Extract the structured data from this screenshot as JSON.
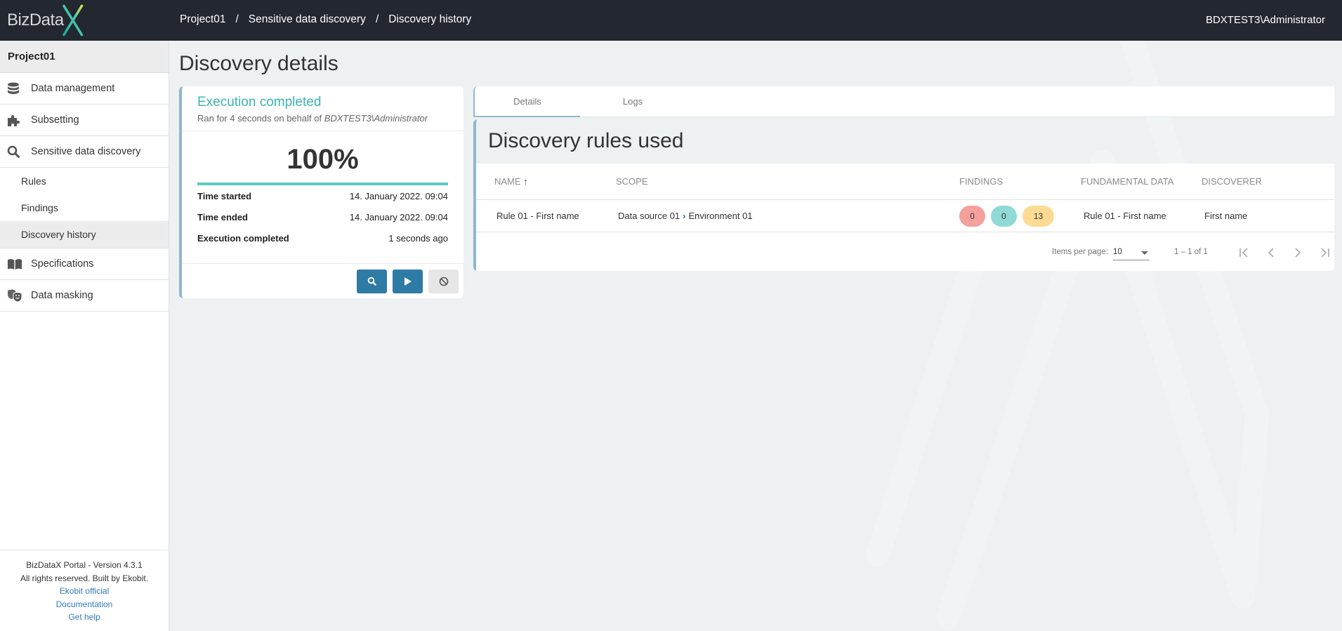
{
  "header": {
    "logo_text": "BizData",
    "breadcrumb": [
      "Project01",
      "Sensitive data discovery",
      "Discovery history"
    ],
    "breadcrumb_separator": "/",
    "user": "BDXTEST3\\Administrator"
  },
  "sidebar": {
    "project": "Project01",
    "items": [
      {
        "label": "Data management",
        "icon": "database-icon"
      },
      {
        "label": "Subsetting",
        "icon": "puzzle-icon"
      },
      {
        "label": "Sensitive data discovery",
        "icon": "search-icon"
      }
    ],
    "sub_items": [
      {
        "label": "Rules",
        "active": false
      },
      {
        "label": "Findings",
        "active": false
      },
      {
        "label": "Discovery history",
        "active": true
      }
    ],
    "items_after": [
      {
        "label": "Specifications",
        "icon": "book-icon"
      },
      {
        "label": "Data masking",
        "icon": "masks-icon"
      }
    ],
    "footer": {
      "version": "BizDataX Portal - Version 4.3.1",
      "rights": "All rights reserved. Built by Ekobit.",
      "links": [
        "Ekobit official",
        "Documentation",
        "Get help"
      ]
    }
  },
  "main": {
    "title": "Discovery details",
    "execution": {
      "status": "Execution completed",
      "ran_for_prefix": "Ran for 4 seconds on behalf of ",
      "ran_for_user": "BDXTEST3\\Administrator",
      "percent_label": "100%",
      "progress": 1.0,
      "rows": [
        {
          "key": "Time started",
          "value": "14. January 2022. 09:04"
        },
        {
          "key": "Time ended",
          "value": "14. January 2022. 09:04"
        },
        {
          "key": "Execution completed",
          "value": "1 seconds ago"
        }
      ],
      "buttons": [
        "search",
        "run",
        "cancel"
      ]
    },
    "tabs": [
      {
        "label": "Details",
        "active": true
      },
      {
        "label": "Logs",
        "active": false
      }
    ],
    "rules_title": "Discovery rules used",
    "table": {
      "columns": [
        "NAME",
        "SCOPE",
        "FINDINGS",
        "FUNDAMENTAL DATA",
        "DISCOVERER"
      ],
      "sort": {
        "column": "NAME",
        "direction": "asc"
      },
      "rows": [
        {
          "name": "Rule 01 - First name",
          "scope_source": "Data source 01",
          "scope_env": "Environment 01",
          "findings": {
            "red": "0",
            "teal": "0",
            "yellow": "13"
          },
          "fundamental_data": "Rule 01 - First name",
          "discoverer": "First name"
        }
      ]
    },
    "paginator": {
      "items_per_page_label": "Items per page:",
      "items_per_page": "10",
      "range": "1 – 1 of 1"
    }
  },
  "colors": {
    "header_bg": "#222730",
    "accent_teal": "#3bb3b0",
    "primary_button": "#2e7ba5",
    "badge_red": "#f4a09c",
    "badge_teal": "#8fd9d6",
    "badge_yellow": "#fddb93"
  }
}
